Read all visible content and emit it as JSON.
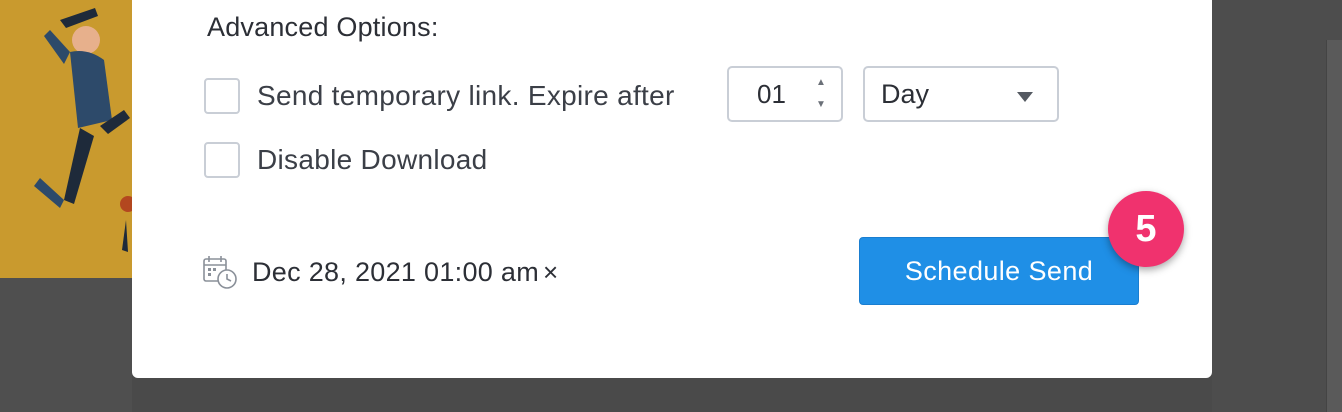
{
  "advanced_options": {
    "title": "Advanced Options:",
    "temporary_link": {
      "label": "Send temporary link. Expire after",
      "checked": false,
      "expire_value": "01",
      "unit_selected": "Day"
    },
    "disable_download": {
      "label": "Disable Download",
      "checked": false
    }
  },
  "schedule": {
    "datetime": "Dec 28, 2021 01:00 am",
    "clear_symbol": "×",
    "icon": "calendar-clock-icon"
  },
  "actions": {
    "schedule_send_label": "Schedule Send"
  },
  "step_badge": {
    "number": "5",
    "color": "#f0326e"
  },
  "colors": {
    "primary_button": "#1f8fe6",
    "background_illustration": "#c99a2e"
  }
}
